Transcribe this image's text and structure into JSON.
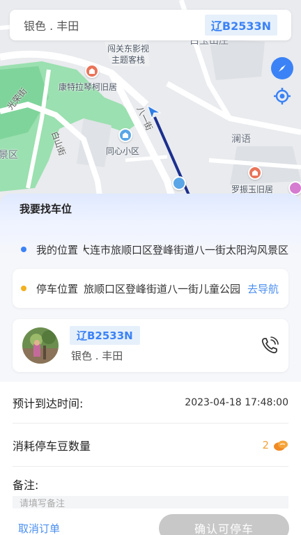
{
  "header": {
    "car_desc": "银色 . 丰田",
    "plate": "辽B2533N"
  },
  "map": {
    "labels": {
      "place1_line1": "闯关东影视",
      "place1_line2": "主题客栈",
      "place2": "康特拉琴柯旧居",
      "street1": "光荣街",
      "street2": "白山街",
      "area1": "景区",
      "place3": "同心小区",
      "street3": "八一街",
      "place4": "澜语",
      "place5": "罗振玉旧居",
      "top_partial": "白玉山庄"
    },
    "icons": [
      "compass-icon",
      "locate-icon",
      "navigation-arrow-icon"
    ]
  },
  "panel": {
    "title": "我要找车位",
    "my_location_label": "我的位置",
    "my_location_value": "大连市旅顺口区登峰街道八一街太阳沟风景区",
    "parking_location_label": "停车位置",
    "parking_location_value": "旅顺口区登峰街道八一街儿童公园",
    "navigate_label": "去导航",
    "colors": {
      "my_dot": "#3b82f6",
      "park_dot": "#f2b01e",
      "accent": "#4a8ef0"
    }
  },
  "car_card": {
    "plate": "辽B2533N",
    "car_desc": "银色 . 丰田",
    "icon": "phone-icon"
  },
  "form": {
    "eta_label": "预计到达时间:",
    "eta_value": "2023-04-18 17:48:00",
    "beans_label": "消耗停车豆数量",
    "beans_value": "2",
    "remark_label": "备注:",
    "remark_placeholder": "请填写备注"
  },
  "footer": {
    "cancel_label": "取消订单",
    "confirm_label": "确认可停车"
  }
}
